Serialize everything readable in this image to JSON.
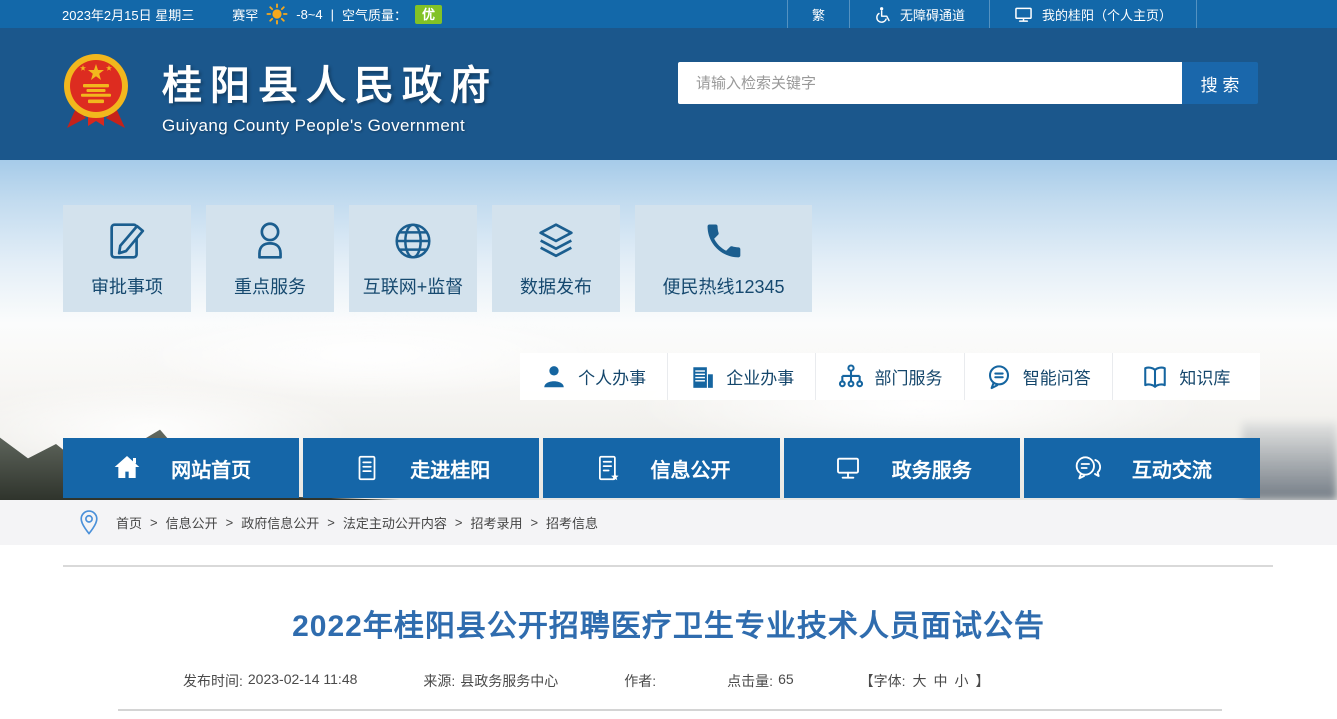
{
  "colors": {
    "topbar_bg": "#1368a9",
    "header_bg": "#1b578c",
    "nav_blue": "#1566a8",
    "icon_blue": "#1b5e8f",
    "card_bg": "#d3e2ed",
    "aqi_green": "#82c226",
    "title_blue": "#2f6cae"
  },
  "topbar": {
    "date": "2023年2月15日 星期三",
    "weather_city": "赛罕",
    "temperature": "-8~4",
    "divider": "|",
    "air_quality_label": "空气质量：",
    "air_quality_value": "优",
    "traditional_label": "繁",
    "accessibility_label": "无障碍通道",
    "my_portal_label": "我的桂阳（个人主页）"
  },
  "header": {
    "site_name": "桂阳县人民政府",
    "site_name_en": "Guiyang County People's Government",
    "search_placeholder": "请输入检索关键字",
    "search_button_label": "搜 索"
  },
  "quick_cards": [
    {
      "label": "审批事项",
      "icon": "edit-icon"
    },
    {
      "label": "重点服务",
      "icon": "user-outline-icon"
    },
    {
      "label": "互联网+监督",
      "icon": "globe-icon"
    },
    {
      "label": "数据发布",
      "icon": "layers-icon"
    },
    {
      "label": "便民热线12345",
      "icon": "phone-icon"
    }
  ],
  "service_bar": [
    {
      "label": "个人办事",
      "icon": "person-icon"
    },
    {
      "label": "企业办事",
      "icon": "building-icon"
    },
    {
      "label": "部门服务",
      "icon": "org-chart-icon"
    },
    {
      "label": "智能问答",
      "icon": "qa-bubble-icon"
    },
    {
      "label": "知识库",
      "icon": "book-icon"
    }
  ],
  "main_nav": [
    {
      "label": "网站首页",
      "icon": "home-icon"
    },
    {
      "label": "走进桂阳",
      "icon": "document-icon"
    },
    {
      "label": "信息公开",
      "icon": "document-star-icon"
    },
    {
      "label": "政务服务",
      "icon": "monitor-icon"
    },
    {
      "label": "互动交流",
      "icon": "chat-icon"
    }
  ],
  "breadcrumb": {
    "separator": ">",
    "items": [
      "首页",
      "信息公开",
      "政府信息公开",
      "法定主动公开内容",
      "招考录用",
      "招考信息"
    ]
  },
  "article": {
    "title": "2022年桂阳县公开招聘医疗卫生专业技术人员面试公告",
    "meta": {
      "publish_time_label": "发布时间:",
      "publish_time": "2023-02-14 11:48",
      "source_label": "来源:",
      "source": "县政务服务中心",
      "author_label": "作者:",
      "author": "",
      "hits_label": "点击量:",
      "hits": "65",
      "font_prefix": "【字体:",
      "font_large": "大",
      "font_medium": "中",
      "font_small": "小",
      "font_suffix": "】"
    }
  }
}
